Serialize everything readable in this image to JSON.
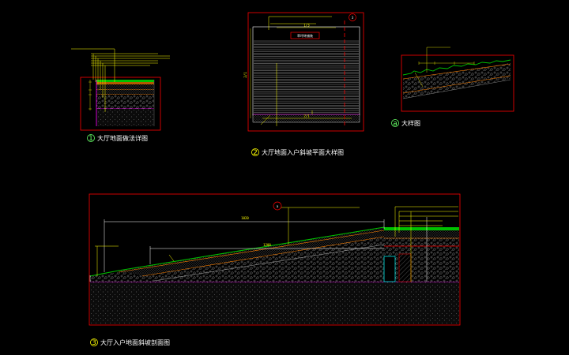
{
  "colors": {
    "background": "#000000",
    "frame_red": "#ff0000",
    "leader_yellow": "#ffff00",
    "grass_green": "#00c000",
    "orange_layer": "#ff8000",
    "magenta_layer": "#ff00ff",
    "gravel_gray": "#8a8a8a",
    "cyan_line": "#00ffff",
    "label_green": "#66ff66"
  },
  "details": {
    "d1": {
      "number": "1",
      "title": "大厅地面做法详图"
    },
    "d2": {
      "number": "2",
      "title": "大厅地面入户斜坡平面大样图",
      "tag": "3",
      "sign": "草坪砖铺装",
      "dim_top": "1/3",
      "dim_bottom": "2/1",
      "dim_side": "2/1"
    },
    "da": {
      "number": "a",
      "title": "大样图"
    },
    "d3": {
      "number": "3",
      "title": "大厅入户地面斜坡剖面图",
      "tag": "a",
      "dim_upper": "1020",
      "dim_lower": "1200"
    }
  }
}
